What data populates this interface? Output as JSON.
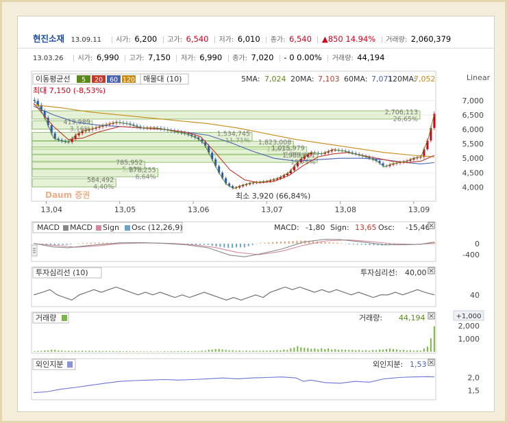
{
  "header": {
    "name": "현진소재",
    "date": "13.09.11",
    "open_label": "시가:",
    "open": "6,200",
    "high_label": "고가:",
    "high": "6,540",
    "low_label": "저가:",
    "low": "6,010",
    "close_label": "종가:",
    "close": "6,540",
    "change": "▲850 14.94%",
    "volume_label": "거래량:",
    "volume": "2,060,379"
  },
  "header2": {
    "date": "13.03.26",
    "open_label": "시가:",
    "open": "6,990",
    "high_label": "고가:",
    "high": "7,150",
    "low_label": "저가:",
    "low": "6,990",
    "close_label": "종가:",
    "close": "7,020",
    "change": "- 0 0.00%",
    "volume_label": "거래량:",
    "volume": "44,194"
  },
  "colors": {
    "ma5": "#5b8a1a",
    "ma20": "#c0392b",
    "ma60": "#4a63b3",
    "ma120": "#c98a12",
    "up": "#d0021b",
    "down": "#2b55c6",
    "box": "#cfe8b2"
  },
  "main_panel": {
    "scale_label": "Linear",
    "legend_title": "이동평균선",
    "legend_periods": [
      "5",
      "20",
      "60",
      "120"
    ],
    "profile_label": "매물대 (10)",
    "ma_readout": {
      "ma5_label": "5MA:",
      "ma5": "7,024",
      "ma20_label": "20MA:",
      "ma20": "7,103",
      "ma60_label": "60MA:",
      "ma60": "7,071",
      "ma120_label": "120MA:",
      "ma120": "7,052"
    },
    "max_annotation": "최대 7,150 (-8,53%)",
    "min_annotation": "최소 3,920 (66,84%)",
    "watermark": "Daum 증권"
  },
  "chart_data": [
    {
      "type": "candlestick",
      "title": "",
      "x_tick_labels": [
        "13,04",
        "13,05",
        "13,06",
        "13,07",
        "13,08",
        "13,09"
      ],
      "y_tick_labels": [
        "7,000",
        "6,500",
        "6,000",
        "5,500",
        "5,000",
        "4,500",
        "4,000"
      ],
      "ylim": [
        3700,
        7400
      ],
      "x_month_range": [
        3.8,
        9.3
      ],
      "close_path": [
        [
          3.83,
          7020
        ],
        [
          3.9,
          6800
        ],
        [
          4.0,
          6300
        ],
        [
          4.1,
          5700
        ],
        [
          4.2,
          5600
        ],
        [
          4.3,
          5550
        ],
        [
          4.4,
          5800
        ],
        [
          4.5,
          5950
        ],
        [
          4.6,
          6000
        ],
        [
          4.8,
          6150
        ],
        [
          4.95,
          6250
        ],
        [
          5.1,
          6200
        ],
        [
          5.3,
          6050
        ],
        [
          5.5,
          6050
        ],
        [
          5.7,
          5950
        ],
        [
          5.9,
          5850
        ],
        [
          6.05,
          5700
        ],
        [
          6.15,
          5500
        ],
        [
          6.25,
          5000
        ],
        [
          6.35,
          4500
        ],
        [
          6.45,
          4100
        ],
        [
          6.55,
          3950
        ],
        [
          6.65,
          4050
        ],
        [
          6.8,
          4150
        ],
        [
          7.0,
          4200
        ],
        [
          7.15,
          4300
        ],
        [
          7.3,
          4500
        ],
        [
          7.45,
          4950
        ],
        [
          7.6,
          5200
        ],
        [
          7.75,
          5150
        ],
        [
          7.9,
          5300
        ],
        [
          8.05,
          5250
        ],
        [
          8.2,
          5150
        ],
        [
          8.35,
          5050
        ],
        [
          8.5,
          4900
        ],
        [
          8.6,
          4700
        ],
        [
          8.7,
          4800
        ],
        [
          8.8,
          4850
        ],
        [
          8.9,
          4900
        ],
        [
          9.0,
          5000
        ],
        [
          9.1,
          5050
        ],
        [
          9.2,
          5700
        ],
        [
          9.28,
          6540
        ]
      ],
      "ma20_path": [
        [
          3.83,
          6900
        ],
        [
          4.1,
          6100
        ],
        [
          4.3,
          5650
        ],
        [
          4.5,
          5700
        ],
        [
          4.7,
          5900
        ],
        [
          5.0,
          6100
        ],
        [
          5.3,
          6050
        ],
        [
          5.6,
          6000
        ],
        [
          5.9,
          5900
        ],
        [
          6.1,
          5750
        ],
        [
          6.3,
          5200
        ],
        [
          6.5,
          4600
        ],
        [
          6.7,
          4250
        ],
        [
          6.9,
          4150
        ],
        [
          7.1,
          4200
        ],
        [
          7.3,
          4400
        ],
        [
          7.5,
          4750
        ],
        [
          7.7,
          5050
        ],
        [
          7.9,
          5150
        ],
        [
          8.1,
          5200
        ],
        [
          8.3,
          5100
        ],
        [
          8.5,
          5000
        ],
        [
          8.7,
          4900
        ],
        [
          8.9,
          4850
        ],
        [
          9.1,
          4900
        ],
        [
          9.28,
          5100
        ]
      ],
      "ma60_path": [
        [
          3.83,
          6800
        ],
        [
          4.1,
          6500
        ],
        [
          4.4,
          6250
        ],
        [
          4.7,
          6150
        ],
        [
          5.0,
          6100
        ],
        [
          5.3,
          6050
        ],
        [
          5.6,
          6000
        ],
        [
          5.9,
          5900
        ],
        [
          6.2,
          5800
        ],
        [
          6.5,
          5550
        ],
        [
          6.8,
          5250
        ],
        [
          7.1,
          5000
        ],
        [
          7.4,
          4900
        ],
        [
          7.7,
          4950
        ],
        [
          8.0,
          5000
        ],
        [
          8.3,
          5000
        ],
        [
          8.6,
          4950
        ],
        [
          8.9,
          4850
        ],
        [
          9.1,
          4800
        ],
        [
          9.28,
          4850
        ]
      ],
      "ma120_path": [
        [
          3.83,
          6850
        ],
        [
          4.2,
          6750
        ],
        [
          4.6,
          6600
        ],
        [
          5.0,
          6500
        ],
        [
          5.4,
          6400
        ],
        [
          5.8,
          6300
        ],
        [
          6.2,
          6200
        ],
        [
          6.6,
          6050
        ],
        [
          7.0,
          5850
        ],
        [
          7.4,
          5650
        ],
        [
          7.8,
          5500
        ],
        [
          8.2,
          5350
        ],
        [
          8.6,
          5200
        ],
        [
          9.0,
          5100
        ],
        [
          9.28,
          5050
        ]
      ],
      "volume_profile": [
        {
          "price": 6500,
          "volume": 2706113,
          "label": "2,706,113",
          "pct_label": "26,65%"
        },
        {
          "price": 6150,
          "volume": 419989,
          "label": "419,989",
          "pct_label": "3,16%"
        },
        {
          "price": 5750,
          "volume": 1534745,
          "label": "1,534,745",
          "pct_label": "11,71%"
        },
        {
          "price": 5450,
          "volume": 1823008,
          "label": "1,823,008",
          "pct_label": "13,61%"
        },
        {
          "price": 5250,
          "volume": 1915979,
          "label": "1,015,979",
          "pct_label": "7,75%"
        },
        {
          "price": 5000,
          "volume": 1989881,
          "label": "1,989,881",
          "pct_label": "15,75%"
        },
        {
          "price": 4750,
          "volume": 785952,
          "label": "785,952",
          "pct_label": "5,93%"
        },
        {
          "price": 4500,
          "volume": 878255,
          "label": "878,255",
          "pct_label": "6,64%"
        },
        {
          "price": 4150,
          "volume": 584492,
          "label": "584,492",
          "pct_label": "4,40%"
        }
      ]
    },
    {
      "type": "line",
      "legend": [
        "MACD",
        "MACD",
        "Sign",
        "Osc (12,26,9)"
      ],
      "readout": {
        "macd_label": "MACD:",
        "macd": "-1,80",
        "sign_label": "Sign:",
        "sign": "13,65",
        "osc_label": "Osc:",
        "osc": "-15,46"
      },
      "y_tick_labels": [
        "0",
        "-400"
      ],
      "ylim": [
        -600,
        400
      ],
      "macd_path": [
        [
          3.83,
          10
        ],
        [
          4.1,
          -120
        ],
        [
          4.3,
          -150
        ],
        [
          4.6,
          -60
        ],
        [
          5.0,
          30
        ],
        [
          5.3,
          40
        ],
        [
          5.6,
          10
        ],
        [
          5.9,
          -40
        ],
        [
          6.2,
          -150
        ],
        [
          6.5,
          -420
        ],
        [
          6.7,
          -480
        ],
        [
          6.9,
          -380
        ],
        [
          7.2,
          -200
        ],
        [
          7.5,
          60
        ],
        [
          7.8,
          160
        ],
        [
          8.0,
          150
        ],
        [
          8.3,
          60
        ],
        [
          8.6,
          -40
        ],
        [
          8.9,
          -40
        ],
        [
          9.1,
          -20
        ],
        [
          9.28,
          60
        ]
      ],
      "sign_path": [
        [
          3.83,
          0
        ],
        [
          4.1,
          -60
        ],
        [
          4.4,
          -130
        ],
        [
          4.7,
          -80
        ],
        [
          5.0,
          0
        ],
        [
          5.3,
          30
        ],
        [
          5.7,
          10
        ],
        [
          6.0,
          -40
        ],
        [
          6.3,
          -140
        ],
        [
          6.6,
          -320
        ],
        [
          6.9,
          -400
        ],
        [
          7.2,
          -280
        ],
        [
          7.5,
          -60
        ],
        [
          7.8,
          100
        ],
        [
          8.1,
          140
        ],
        [
          8.4,
          80
        ],
        [
          8.7,
          0
        ],
        [
          9.0,
          -30
        ],
        [
          9.28,
          10
        ]
      ]
    },
    {
      "type": "line",
      "title": "투자심리선",
      "legend": [
        "투자심리선 (10)"
      ],
      "readout": {
        "label": "투자심리선:",
        "value": "40,00"
      },
      "y_tick_labels": [
        "40"
      ],
      "ylim": [
        0,
        100
      ],
      "values_path": [
        [
          3.83,
          40
        ],
        [
          3.95,
          50
        ],
        [
          4.05,
          60
        ],
        [
          4.15,
          40
        ],
        [
          4.25,
          30
        ],
        [
          4.35,
          20
        ],
        [
          4.45,
          40
        ],
        [
          4.55,
          50
        ],
        [
          4.65,
          60
        ],
        [
          4.75,
          50
        ],
        [
          4.85,
          60
        ],
        [
          4.95,
          70
        ],
        [
          5.05,
          60
        ],
        [
          5.15,
          50
        ],
        [
          5.25,
          40
        ],
        [
          5.35,
          50
        ],
        [
          5.45,
          40
        ],
        [
          5.55,
          50
        ],
        [
          5.65,
          40
        ],
        [
          5.75,
          30
        ],
        [
          5.85,
          40
        ],
        [
          5.95,
          30
        ],
        [
          6.05,
          40
        ],
        [
          6.15,
          50
        ],
        [
          6.25,
          40
        ],
        [
          6.35,
          30
        ],
        [
          6.45,
          20
        ],
        [
          6.55,
          30
        ],
        [
          6.65,
          20
        ],
        [
          6.75,
          30
        ],
        [
          6.85,
          40
        ],
        [
          6.95,
          30
        ],
        [
          7.05,
          50
        ],
        [
          7.15,
          60
        ],
        [
          7.25,
          70
        ],
        [
          7.35,
          60
        ],
        [
          7.45,
          70
        ],
        [
          7.55,
          60
        ],
        [
          7.65,
          50
        ],
        [
          7.75,
          60
        ],
        [
          7.85,
          50
        ],
        [
          7.95,
          60
        ],
        [
          8.05,
          50
        ],
        [
          8.15,
          40
        ],
        [
          8.25,
          50
        ],
        [
          8.35,
          40
        ],
        [
          8.45,
          30
        ],
        [
          8.55,
          40
        ],
        [
          8.65,
          40
        ],
        [
          8.75,
          50
        ],
        [
          8.85,
          40
        ],
        [
          8.95,
          50
        ],
        [
          9.05,
          60
        ],
        [
          9.15,
          50
        ],
        [
          9.28,
          40
        ]
      ]
    },
    {
      "type": "bar",
      "title": "거래량",
      "readout": {
        "label": "거래량:",
        "value": "44,194"
      },
      "y_tick_labels": [
        "2,000",
        "1,000"
      ],
      "top_badge": "+1,000",
      "ylim": [
        0,
        2200
      ],
      "values_path": [
        [
          3.83,
          60
        ],
        [
          4.0,
          120
        ],
        [
          4.1,
          180
        ],
        [
          4.2,
          100
        ],
        [
          4.3,
          80
        ],
        [
          4.5,
          90
        ],
        [
          4.7,
          70
        ],
        [
          4.9,
          60
        ],
        [
          5.1,
          50
        ],
        [
          5.3,
          40
        ],
        [
          5.5,
          40
        ],
        [
          5.7,
          50
        ],
        [
          5.9,
          60
        ],
        [
          6.1,
          80
        ],
        [
          6.25,
          200
        ],
        [
          6.35,
          250
        ],
        [
          6.45,
          150
        ],
        [
          6.55,
          120
        ],
        [
          6.7,
          100
        ],
        [
          6.9,
          90
        ],
        [
          7.1,
          120
        ],
        [
          7.3,
          200
        ],
        [
          7.4,
          480
        ],
        [
          7.5,
          350
        ],
        [
          7.6,
          280
        ],
        [
          7.7,
          250
        ],
        [
          7.8,
          300
        ],
        [
          7.9,
          220
        ],
        [
          8.0,
          180
        ],
        [
          8.2,
          150
        ],
        [
          8.4,
          120
        ],
        [
          8.6,
          200
        ],
        [
          8.7,
          280
        ],
        [
          8.8,
          160
        ],
        [
          9.0,
          120
        ],
        [
          9.1,
          110
        ],
        [
          9.2,
          500
        ],
        [
          9.28,
          2060
        ]
      ]
    },
    {
      "type": "line",
      "title": "외인지분",
      "readout": {
        "label": "외인지분:",
        "value": "1,53"
      },
      "y_tick_labels": [
        "2,0",
        "1,5"
      ],
      "ylim": [
        1.2,
        2.3
      ],
      "values_path": [
        [
          3.83,
          1.42
        ],
        [
          4.0,
          1.45
        ],
        [
          4.2,
          1.55
        ],
        [
          4.4,
          1.62
        ],
        [
          4.6,
          1.7
        ],
        [
          4.8,
          1.78
        ],
        [
          5.0,
          1.85
        ],
        [
          5.2,
          1.88
        ],
        [
          5.4,
          1.9
        ],
        [
          5.6,
          1.92
        ],
        [
          5.8,
          1.9
        ],
        [
          6.0,
          1.92
        ],
        [
          6.2,
          1.95
        ],
        [
          6.4,
          1.98
        ],
        [
          6.6,
          1.95
        ],
        [
          6.8,
          1.98
        ],
        [
          7.0,
          2.0
        ],
        [
          7.2,
          2.02
        ],
        [
          7.4,
          1.98
        ],
        [
          7.5,
          1.85
        ],
        [
          7.6,
          1.9
        ],
        [
          7.8,
          1.8
        ],
        [
          8.0,
          1.78
        ],
        [
          8.2,
          1.85
        ],
        [
          8.4,
          1.82
        ],
        [
          8.6,
          1.95
        ],
        [
          8.8,
          2.0
        ],
        [
          9.0,
          2.02
        ],
        [
          9.2,
          2.03
        ],
        [
          9.28,
          2.02
        ]
      ]
    }
  ]
}
